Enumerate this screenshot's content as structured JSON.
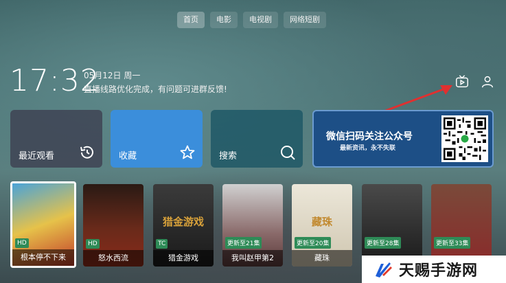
{
  "nav": {
    "tabs": [
      {
        "label": "首页",
        "active": true
      },
      {
        "label": "电影",
        "active": false
      },
      {
        "label": "电视剧",
        "active": false
      },
      {
        "label": "网络短剧",
        "active": false
      }
    ]
  },
  "status": {
    "time": "17:32",
    "date": "05月12日 周一",
    "notice": "直播线路优化完成，有问题可进群反馈!"
  },
  "top_icons": [
    "cast-tv-icon",
    "user-icon"
  ],
  "cards": {
    "recent": {
      "label": "最近观看",
      "icon": "history-icon"
    },
    "favorites": {
      "label": "收藏",
      "icon": "star-icon"
    },
    "search": {
      "label": "搜索",
      "icon": "search-icon"
    }
  },
  "qr_card": {
    "title": "微信扫码关注公众号",
    "subtitle": "最新资讯，永不失联",
    "icon": "qr-code-icon"
  },
  "posters": [
    {
      "title": "根本停不下来",
      "badge": "HD",
      "art_text": "",
      "color_top": "#4aa3d8",
      "color_bottom": "#c23b2a"
    },
    {
      "title": "怒水西流",
      "badge": "HD",
      "art_text": "",
      "color_top": "#2a1a14",
      "color_bottom": "#8a2a1a"
    },
    {
      "title": "猎金游戏",
      "badge": "TC",
      "art_text": "猎金游戏",
      "color_top": "#2b2b2b",
      "color_bottom": "#0f0f0f"
    },
    {
      "title": "我叫赵甲第2",
      "badge": "更新至21集",
      "art_text": "",
      "color_top": "#c9c9c9",
      "color_bottom": "#5a3a3a"
    },
    {
      "title": "藏珠",
      "badge": "更新至20集",
      "art_text": "藏珠",
      "color_top": "#e9e4d6",
      "color_bottom": "#cfc6b0"
    },
    {
      "title": "",
      "badge": "更新至28集",
      "art_text": "",
      "color_top": "#3a3a3a",
      "color_bottom": "#1a1a1a"
    },
    {
      "title": "",
      "badge": "更新至33集",
      "art_text": "",
      "color_top": "#6a3a2a",
      "color_bottom": "#8a2a2a"
    }
  ],
  "watermark": {
    "text": "天赐手游网"
  }
}
